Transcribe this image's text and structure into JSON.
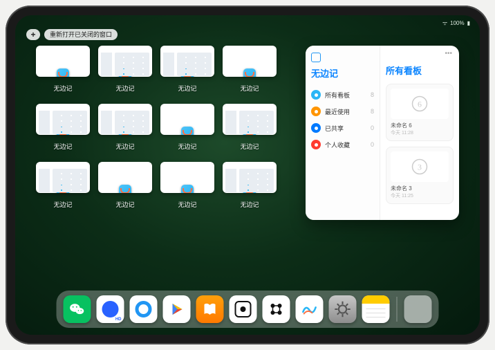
{
  "status": {
    "time": "",
    "wifi": "᯾",
    "battery_text": "100%"
  },
  "top": {
    "plus": "+",
    "reopen_label": "重新打开已关闭的窗口"
  },
  "app_name": "无边记",
  "windows": [
    {
      "label": "无边记",
      "variant": "blank"
    },
    {
      "label": "无边记",
      "variant": "detailed"
    },
    {
      "label": "无边记",
      "variant": "detailed"
    },
    {
      "label": "无边记",
      "variant": "blank"
    },
    {
      "label": "无边记",
      "variant": "detailed"
    },
    {
      "label": "无边记",
      "variant": "detailed"
    },
    {
      "label": "无边记",
      "variant": "blank"
    },
    {
      "label": "无边记",
      "variant": "detailed"
    },
    {
      "label": "无边记",
      "variant": "detailed"
    },
    {
      "label": "无边记",
      "variant": "blank"
    },
    {
      "label": "无边记",
      "variant": "blank"
    },
    {
      "label": "无边记",
      "variant": "detailed"
    }
  ],
  "panel": {
    "title": "无边记",
    "right_title": "所有看板",
    "rows": [
      {
        "icon_color": "#29B6F6",
        "label": "所有看板",
        "count": "8"
      },
      {
        "icon_color": "#FF9500",
        "label": "最近使用",
        "count": "8"
      },
      {
        "icon_color": "#007AFF",
        "label": "已共享",
        "count": "0"
      },
      {
        "icon_color": "#FF3B30",
        "label": "个人收藏",
        "count": "0"
      }
    ],
    "boards": [
      {
        "name": "未命名 6",
        "date": "今天 11:28",
        "glyph": "6"
      },
      {
        "name": "未命名 3",
        "date": "今天 11:25",
        "glyph": "3"
      }
    ]
  },
  "dock": [
    {
      "name": "wechat",
      "bg": "#07C160",
      "glyph": "✿"
    },
    {
      "name": "quark-hd",
      "bg": "#fff",
      "glyph": "◯",
      "sub": "HD"
    },
    {
      "name": "quark",
      "bg": "#fff",
      "glyph": "◯"
    },
    {
      "name": "play",
      "bg": "#fff",
      "glyph": "▶"
    },
    {
      "name": "books",
      "bg": "#FF9500",
      "glyph": "▮▮"
    },
    {
      "name": "dice",
      "bg": "#fff",
      "glyph": "⸬"
    },
    {
      "name": "dots",
      "bg": "#fff",
      "glyph": "⋮⋮"
    },
    {
      "name": "freeform",
      "bg": "#fff",
      "glyph": "∿"
    },
    {
      "name": "settings",
      "bg": "linear-gradient(#b5b5b5,#8e8e8e)",
      "glyph": "⚙"
    },
    {
      "name": "notes",
      "bg": "#fff",
      "glyph": ""
    },
    {
      "name": "recent-apps",
      "bg": "",
      "glyph": ""
    }
  ]
}
